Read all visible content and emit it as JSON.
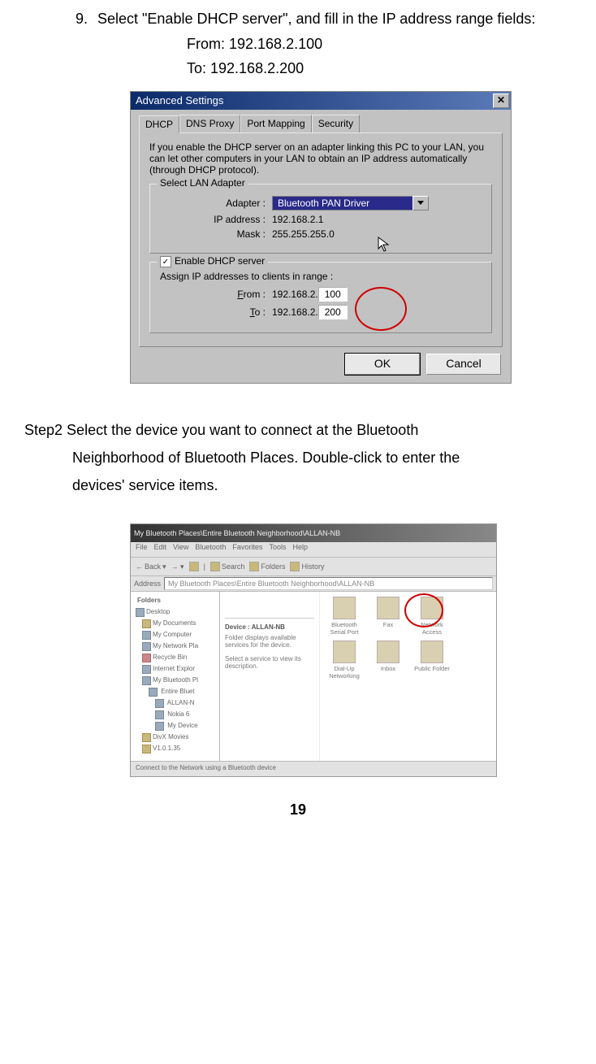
{
  "instructions": {
    "step_label": "9.",
    "step_text": "Select \"Enable DHCP server\", and fill in the IP address range fields:",
    "from_line": "From: 192.168.2.100",
    "to_line": "To: 192.168.2.200",
    "step2_prefix": "Step2",
    "step2_text": " Select the device you want to connect at the Bluetooth",
    "step2_cont1": "Neighborhood of Bluetooth Places. Double-click to enter the",
    "step2_cont2": "devices' service items."
  },
  "dialog1": {
    "title": "Advanced Settings",
    "tabs": [
      "DHCP",
      "DNS Proxy",
      "Port Mapping",
      "Security"
    ],
    "desc": "If you enable the DHCP server on an adapter linking this PC to your LAN, you can let other computers in your LAN to obtain an IP address automatically (through DHCP protocol).",
    "lan_legend": "Select LAN Adapter",
    "adapter_label": "Adapter :",
    "adapter_value": "Bluetooth PAN Driver",
    "ip_label": "IP address :",
    "ip_value": "192.168.2.1",
    "mask_label": "Mask :",
    "mask_value": "255.255.255.0",
    "dhcp_check_label": "Enable DHCP server",
    "assign_text": "Assign IP addresses to clients in range :",
    "from_label": "From :",
    "to_label": "To :",
    "range_prefix": "192.168.2.",
    "from_val": "100",
    "to_val": "200",
    "ok": "OK",
    "cancel": "Cancel"
  },
  "dialog2": {
    "title": "My Bluetooth Places\\Entire Bluetooth Neighborhood\\ALLAN-NB",
    "menus": [
      "File",
      "Edit",
      "View",
      "Bluetooth",
      "Favorites",
      "Tools",
      "Help"
    ],
    "toolbar": {
      "back": "Back",
      "search": "Search",
      "folders": "Folders",
      "history": "History"
    },
    "address_label": "Address",
    "address_value": "My Bluetooth Places\\Entire Bluetooth Neighborhood\\ALLAN-NB",
    "folders_hdr": "Folders",
    "tree": [
      "Desktop",
      "My Documents",
      "My Computer",
      "My Network Pla",
      "Recycle Bin",
      "Internet Explor",
      "My Bluetooth Pl",
      " Entire Bluet",
      "  ALLAN-N",
      "  Nokia 6",
      "  My Device",
      "DivX Movies",
      "V1.0.1.35"
    ],
    "info_heading": "Device : ALLAN-NB",
    "info_sub1": "Folder displays available services for the device.",
    "info_sub2": "Select a service to view its description.",
    "services": [
      "Bluetooth Serial Port",
      "Fax",
      "Network Access",
      "Dial-Up Networking",
      "Inbox",
      "Public Folder"
    ],
    "status": "Connect to the Network using a Bluetooth device"
  },
  "page_number": "19"
}
